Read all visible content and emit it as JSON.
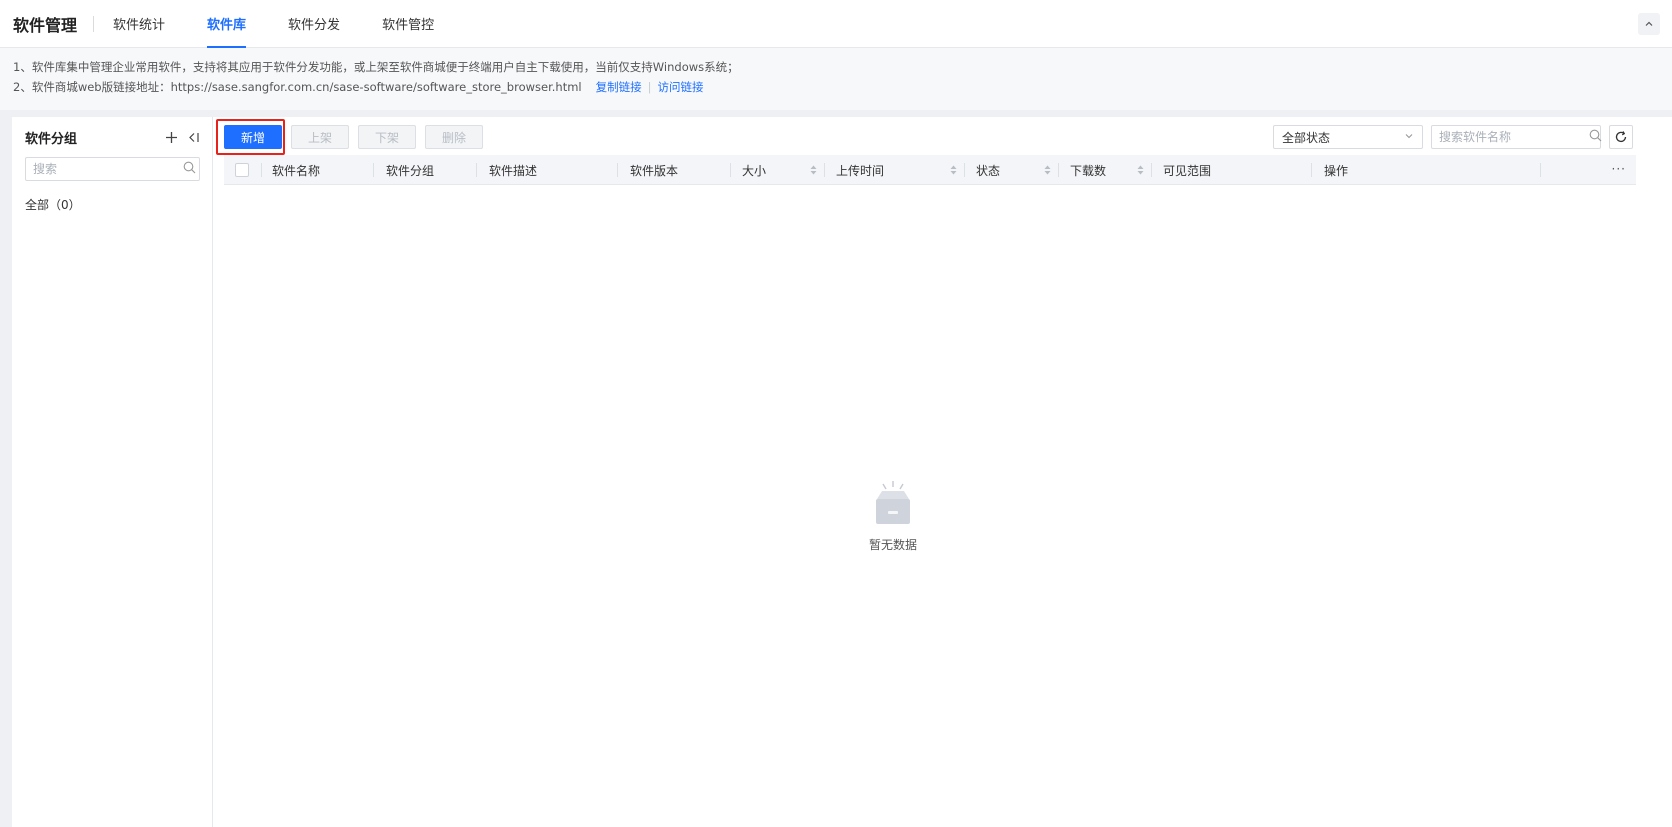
{
  "header": {
    "app_title": "软件管理",
    "tabs": [
      {
        "label": "软件统计",
        "active": false
      },
      {
        "label": "软件库",
        "active": true
      },
      {
        "label": "软件分发",
        "active": false
      },
      {
        "label": "软件管控",
        "active": false
      }
    ],
    "collapse_icon": "chevron-up-icon"
  },
  "notice": {
    "line1": "1、软件库集中管理企业常用软件，支持将其应用于软件分发功能，或上架至软件商城便于终端用户自主下载使用，当前仅支持Windows系统；",
    "line2_prefix": "2、软件商城web版链接地址：https://sase.sangfor.com.cn/sase-software/software_store_browser.html",
    "copy_link": "复制链接",
    "visit_link": "访问链接"
  },
  "sidebar": {
    "title": "软件分组",
    "add_icon": "plus-icon",
    "collapse_icon": "collapse-left-icon",
    "search_placeholder": "搜索",
    "groups": [
      {
        "label": "全部（0）"
      }
    ]
  },
  "toolbar": {
    "add_label": "新增",
    "publish_label": "上架",
    "unpublish_label": "下架",
    "delete_label": "删除"
  },
  "filters": {
    "status_value": "全部状态",
    "search_placeholder": "搜索软件名称"
  },
  "table": {
    "columns": [
      "软件名称",
      "软件分组",
      "软件描述",
      "软件版本",
      "大小",
      "上传时间",
      "状态",
      "下载数",
      "可见范围",
      "操作"
    ],
    "rows": [],
    "empty_text": "暂无数据"
  },
  "colors": {
    "accent": "#1e6fff",
    "highlight": "#e8211a"
  }
}
